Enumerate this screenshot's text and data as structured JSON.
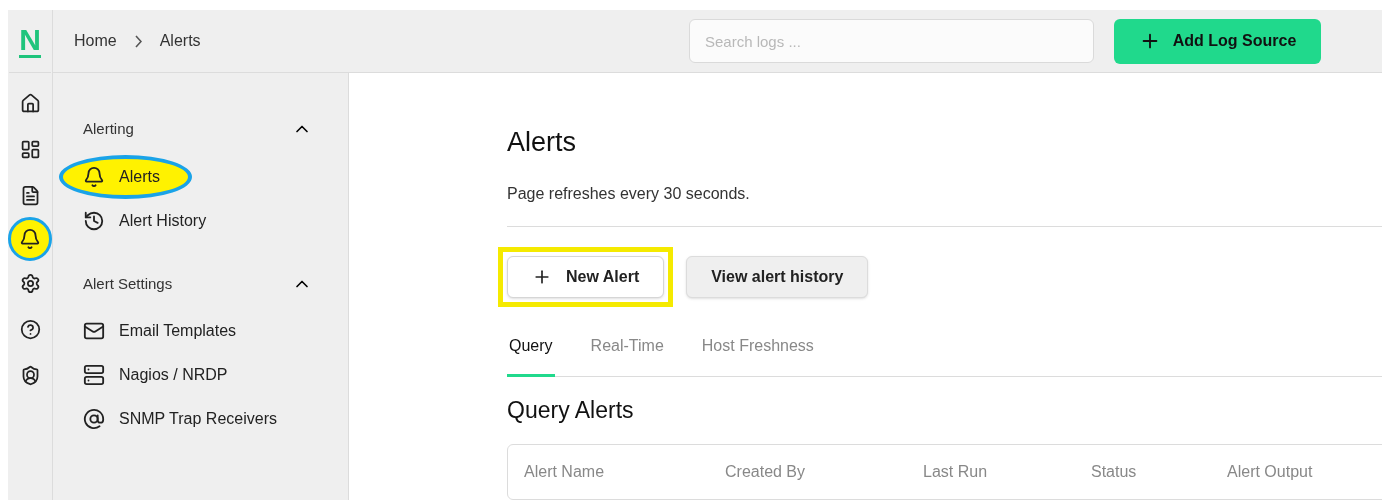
{
  "logo": "N",
  "rail": [
    {
      "kind": "home",
      "selected": false,
      "highlighted": false
    },
    {
      "kind": "dashboard",
      "selected": false,
      "highlighted": false
    },
    {
      "kind": "file",
      "selected": false,
      "highlighted": false
    },
    {
      "kind": "bell",
      "selected": true,
      "highlighted": true
    },
    {
      "kind": "settings",
      "selected": false,
      "highlighted": false
    },
    {
      "kind": "help",
      "selected": false,
      "highlighted": false
    },
    {
      "kind": "shield",
      "selected": false,
      "highlighted": false
    }
  ],
  "breadcrumb": [
    "Home",
    "Alerts"
  ],
  "search": {
    "placeholder": "Search logs ..."
  },
  "add_button": "Add Log Source",
  "sidebar": [
    {
      "title": "Alerting",
      "expanded": true,
      "items": [
        {
          "kind": "bell",
          "label": "Alerts",
          "highlighted": true
        },
        {
          "kind": "history",
          "label": "Alert History",
          "highlighted": false
        }
      ]
    },
    {
      "title": "Alert Settings",
      "expanded": true,
      "items": [
        {
          "kind": "mail",
          "label": "Email Templates",
          "highlighted": false
        },
        {
          "kind": "server",
          "label": "Nagios / NRDP",
          "highlighted": false
        },
        {
          "kind": "at",
          "label": "SNMP Trap Receivers",
          "highlighted": false
        }
      ]
    }
  ],
  "page": {
    "title": "Alerts",
    "subtitle": "Page refreshes every 30 seconds.",
    "buttons": [
      {
        "kind": "primary",
        "label": "New Alert",
        "highlighted": true
      },
      {
        "kind": "secondary",
        "label": "View alert history",
        "highlighted": false
      }
    ],
    "tabs": [
      {
        "label": "Query",
        "selected": true
      },
      {
        "label": "Real-Time",
        "selected": false
      },
      {
        "label": "Host Freshness",
        "selected": false
      }
    ],
    "section_title": "Query Alerts",
    "table": {
      "columns": [
        "Alert Name",
        "Created By",
        "Last Run",
        "Status",
        "Alert Output"
      ]
    }
  }
}
